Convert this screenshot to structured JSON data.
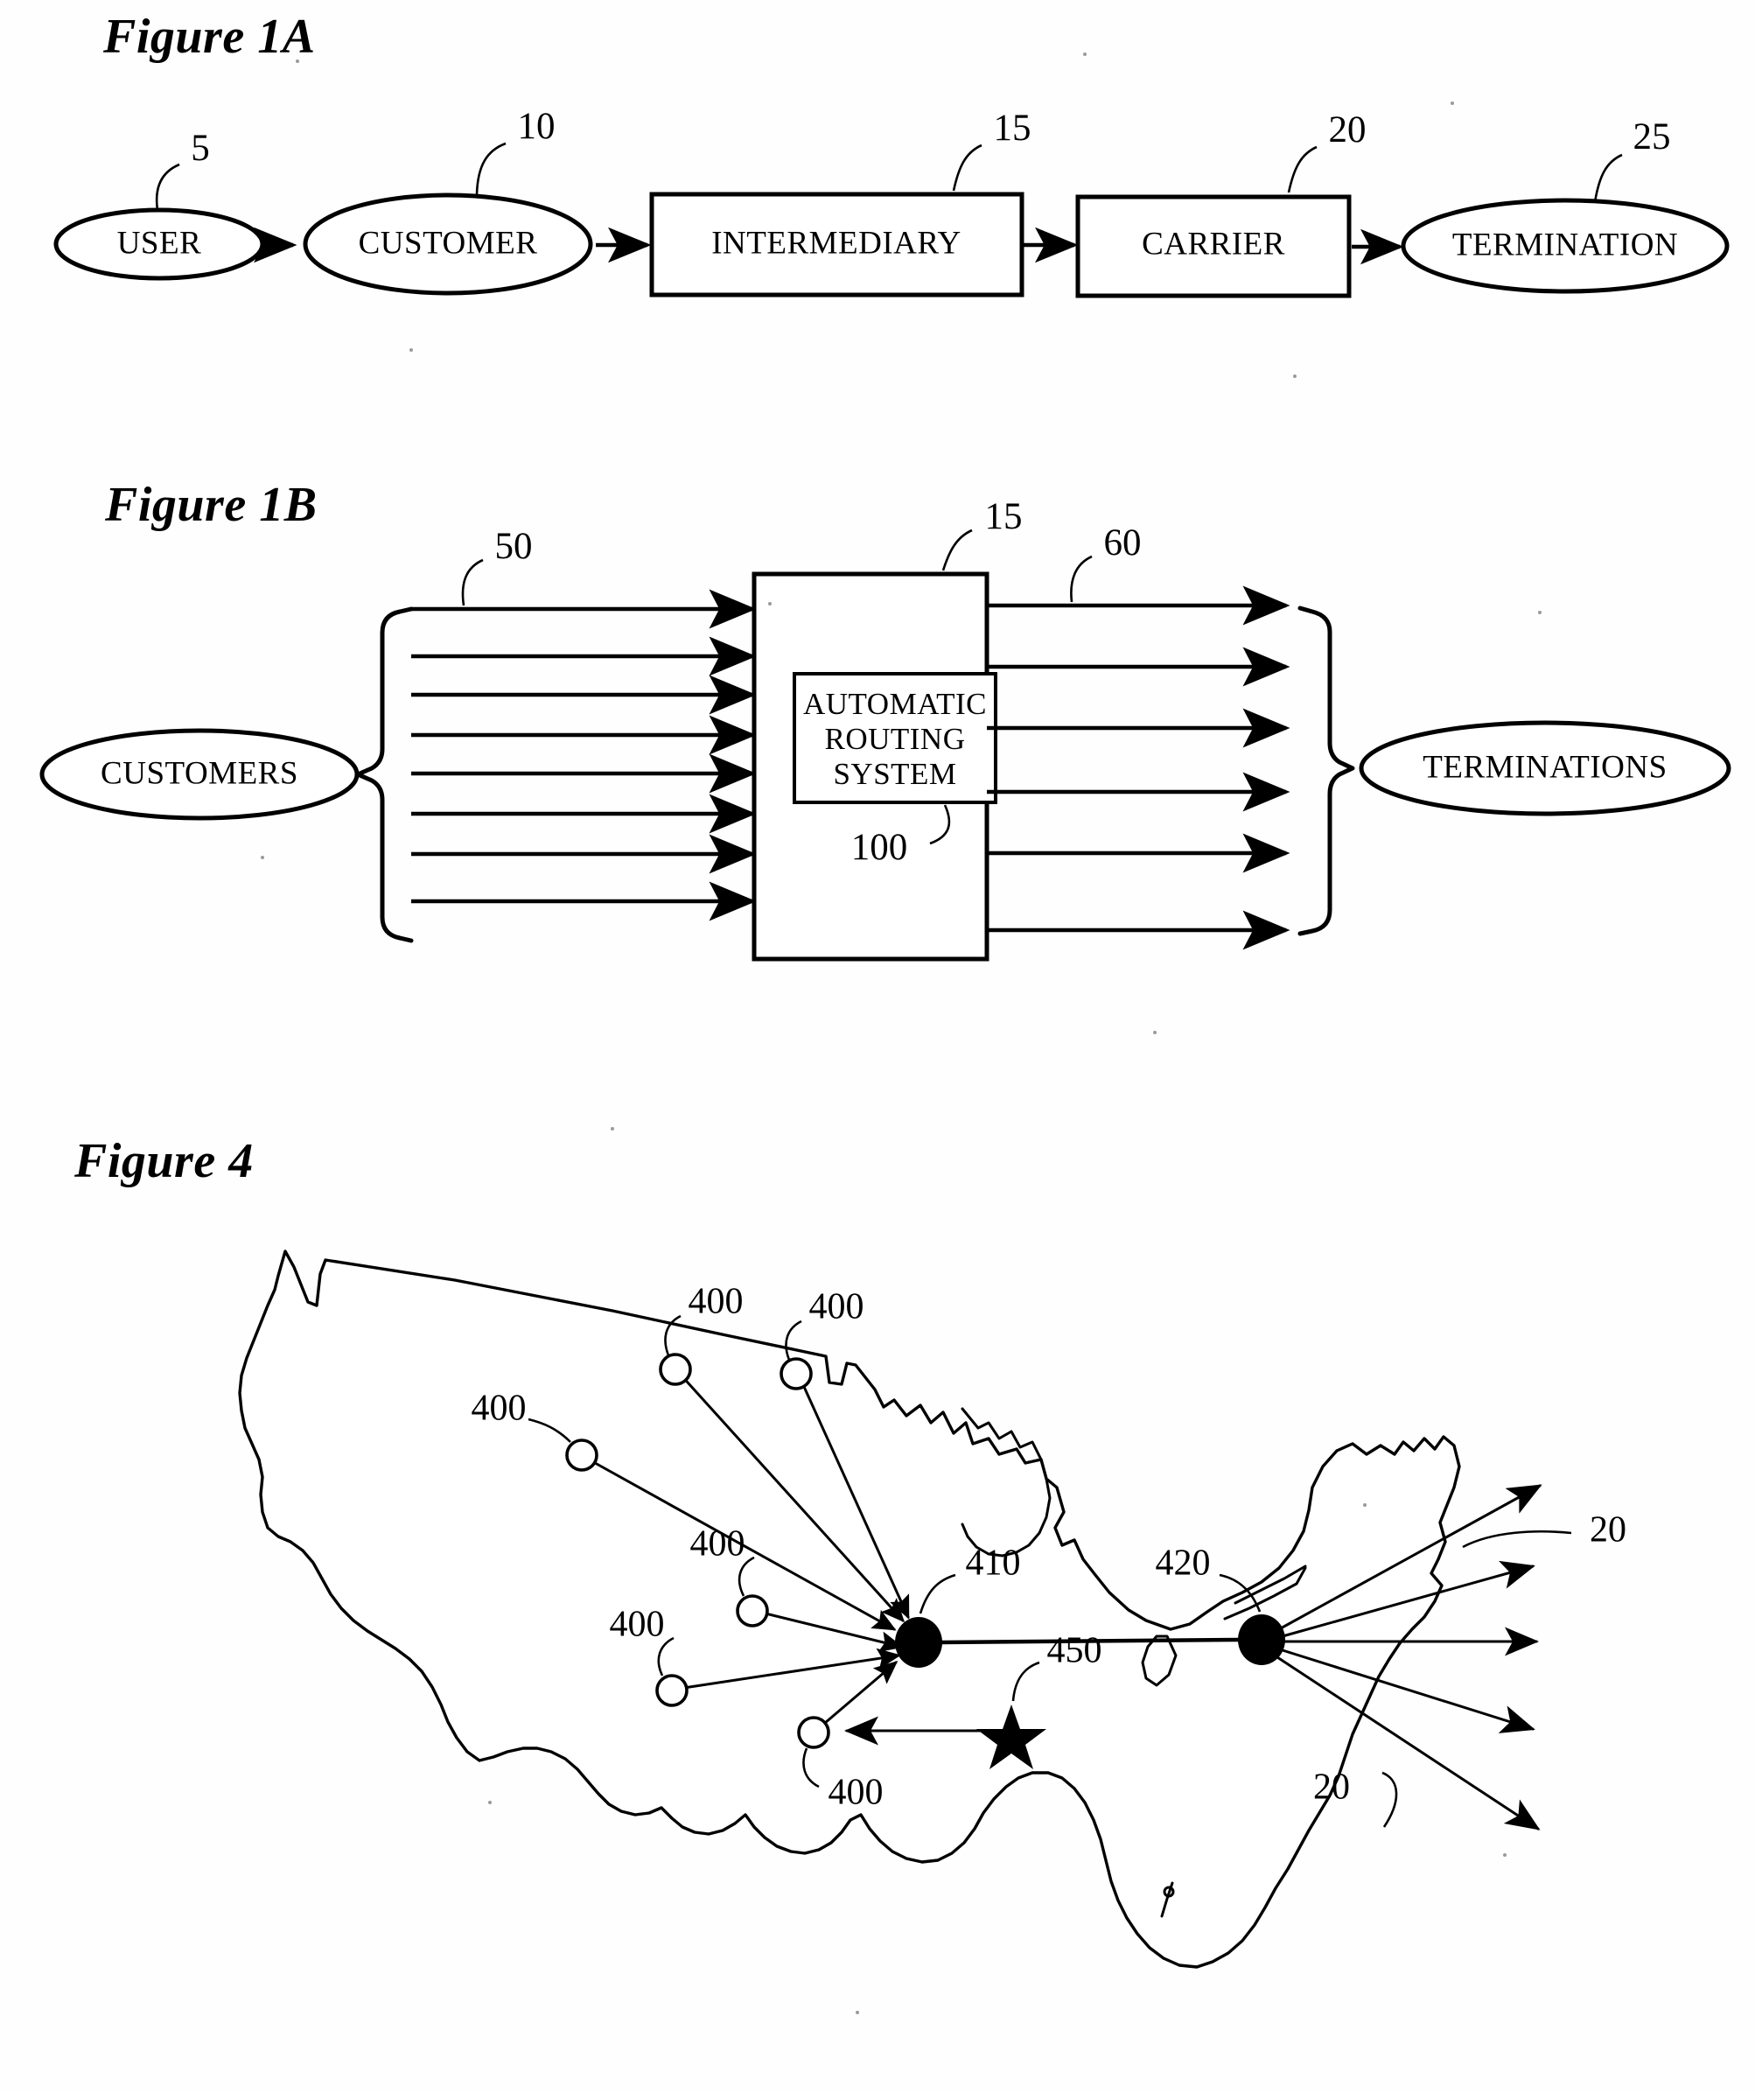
{
  "document": {
    "type": "patent-drawing-sheet",
    "figures": [
      "Figure 1A",
      "Figure 1B",
      "Figure 4"
    ]
  },
  "figure_1a": {
    "caption": "Figure 1A",
    "nodes": [
      {
        "label": "USER",
        "ref": "5",
        "shape": "ellipse"
      },
      {
        "label": "CUSTOMER",
        "ref": "10",
        "shape": "ellipse"
      },
      {
        "label": "INTERMEDIARY",
        "ref": "15",
        "shape": "rect"
      },
      {
        "label": "CARRIER",
        "ref": "20",
        "shape": "rect"
      },
      {
        "label": "TERMINATION",
        "ref": "25",
        "shape": "ellipse"
      }
    ],
    "connector": "arrow-right"
  },
  "figure_1b": {
    "caption": "Figure 1B",
    "source_label": "CUSTOMERS",
    "sink_label": "TERMINATIONS",
    "outer_box_ref": "15",
    "inner_box_label_lines": [
      "AUTOMATIC",
      "ROUTING",
      "SYSTEM"
    ],
    "inner_box_ref": "100",
    "input_bundle_ref": "50",
    "output_bundle_ref": "60",
    "input_arrow_count": 8,
    "output_arrow_count": 6
  },
  "figure_4": {
    "caption": "Figure 4",
    "map_region": "continental-united-states",
    "origin_pop_ref": "400",
    "origin_pop_count": 6,
    "ingress_hub_ref": "410",
    "egress_hub_ref": "420",
    "star_ref": "450",
    "carrier_refs": [
      "20",
      "20"
    ],
    "egress_arrow_count": 5,
    "labels": {
      "pop_1": "400",
      "pop_2": "400",
      "pop_3": "400",
      "pop_4": "400",
      "pop_5": "400",
      "pop_6": "400",
      "hub_left": "410",
      "hub_right": "420",
      "star": "450",
      "carrier_top": "20",
      "carrier_bottom": "20"
    }
  }
}
